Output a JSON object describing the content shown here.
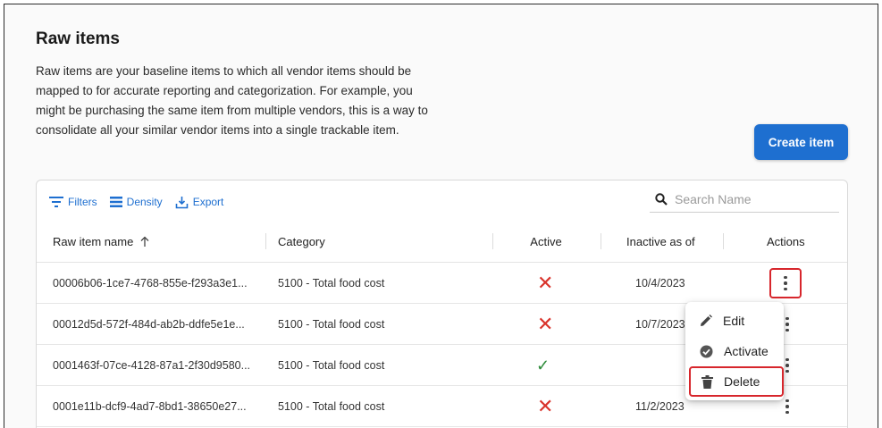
{
  "page": {
    "title": "Raw items",
    "description": "Raw items are your baseline items to which all vendor items should be mapped to for accurate reporting and categorization. For example, you might be purchasing the same item from multiple vendors, this is a way to consolidate all your similar vendor items into a single trackable item.",
    "create_button": "Create item"
  },
  "toolbar": {
    "filters": "Filters",
    "density": "Density",
    "export": "Export",
    "search_placeholder": "Search Name"
  },
  "columns": [
    "Raw item name",
    "Category",
    "Active",
    "Inactive as of",
    "Actions"
  ],
  "sort": {
    "column": "Raw item name",
    "direction": "ascending",
    "icon": "arrow-up-icon"
  },
  "rows": [
    {
      "name": "00006b06-1ce7-4768-855e-f293a3e1...",
      "category": "5100 - Total food cost",
      "active": "no",
      "inactive_as_of": "10/4/2023"
    },
    {
      "name": "00012d5d-572f-484d-ab2b-ddfe5e1e...",
      "category": "5100 - Total food cost",
      "active": "no",
      "inactive_as_of": "10/7/2023"
    },
    {
      "name": "0001463f-07ce-4128-87a1-2f30d9580...",
      "category": "5100 - Total food cost",
      "active": "yes",
      "inactive_as_of": ""
    },
    {
      "name": "0001e11b-dcf9-4ad7-8bd1-38650e27...",
      "category": "5100 - Total food cost",
      "active": "no",
      "inactive_as_of": "11/2/2023"
    }
  ],
  "actions_menu": {
    "open_for_row": 1,
    "items": [
      {
        "label": "Edit",
        "icon": "pencil-icon"
      },
      {
        "label": "Activate",
        "icon": "check-circle-icon"
      },
      {
        "label": "Delete",
        "icon": "trash-icon",
        "highlighted": true
      }
    ]
  },
  "colors": {
    "accent": "#1e6fd0",
    "inactive_mark": "#d9332b",
    "active_mark": "#2e8b3a",
    "highlight_border": "#d7262c"
  }
}
